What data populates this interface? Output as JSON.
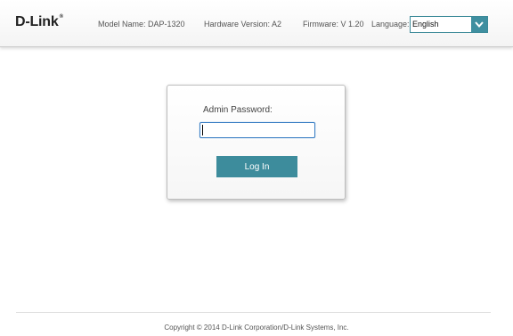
{
  "header": {
    "logo_text": "D-Link",
    "logo_reg": "®",
    "model_name": "Model Name: DAP-1320",
    "hardware_version": "Hardware Version: A2",
    "firmware": "Firmware: V 1.20",
    "language_label": "Language:",
    "language_selected": "English"
  },
  "login": {
    "password_label": "Admin Password:",
    "password_value": "",
    "login_button": "Log In"
  },
  "footer": {
    "copyright": "Copyright © 2014 D-Link Corporation/D-Link Systems, Inc."
  },
  "colors": {
    "accent": "#3d8c9c",
    "input_focus": "#3b7fc4"
  }
}
